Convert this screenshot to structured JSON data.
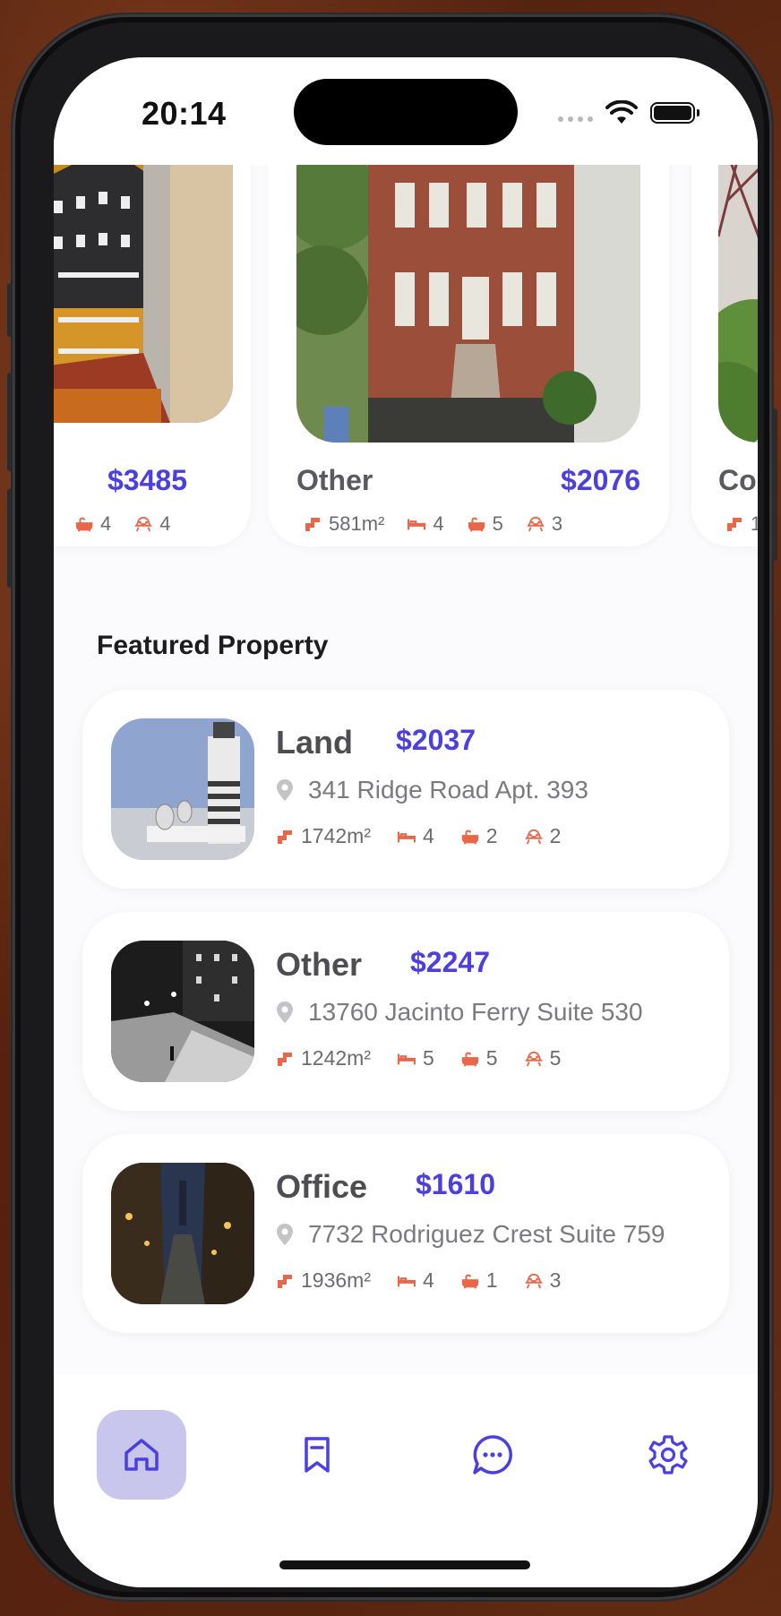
{
  "status": {
    "time": "20:14"
  },
  "carousel": [
    {
      "category": "",
      "price": "$3485",
      "stats": {
        "bath": "4",
        "garage": "4"
      }
    },
    {
      "category": "Other",
      "price": "$2076",
      "stats": {
        "area": "581m²",
        "bed": "4",
        "bath": "5",
        "garage": "3"
      }
    },
    {
      "category": "Co",
      "price": "",
      "stats": {
        "area": "1"
      }
    }
  ],
  "featured": {
    "title": "Featured Property",
    "items": [
      {
        "category": "Land",
        "price": "$2037",
        "address": "341 Ridge Road Apt. 393",
        "area": "1742m²",
        "bed": "4",
        "bath": "2",
        "garage": "2"
      },
      {
        "category": "Other",
        "price": "$2247",
        "address": "13760 Jacinto Ferry Suite 530",
        "area": "1242m²",
        "bed": "5",
        "bath": "5",
        "garage": "5"
      },
      {
        "category": "Office",
        "price": "$1610",
        "address": "7732 Rodriguez Crest Suite 759",
        "area": "1936m²",
        "bed": "4",
        "bath": "1",
        "garage": "3"
      }
    ]
  },
  "tabs": [
    "home-icon",
    "bookmark-icon",
    "chat-icon",
    "settings-icon"
  ],
  "colors": {
    "accent": "#4b3fe0",
    "icon": "#e8674a",
    "active_tab": "#c9c6ee"
  }
}
